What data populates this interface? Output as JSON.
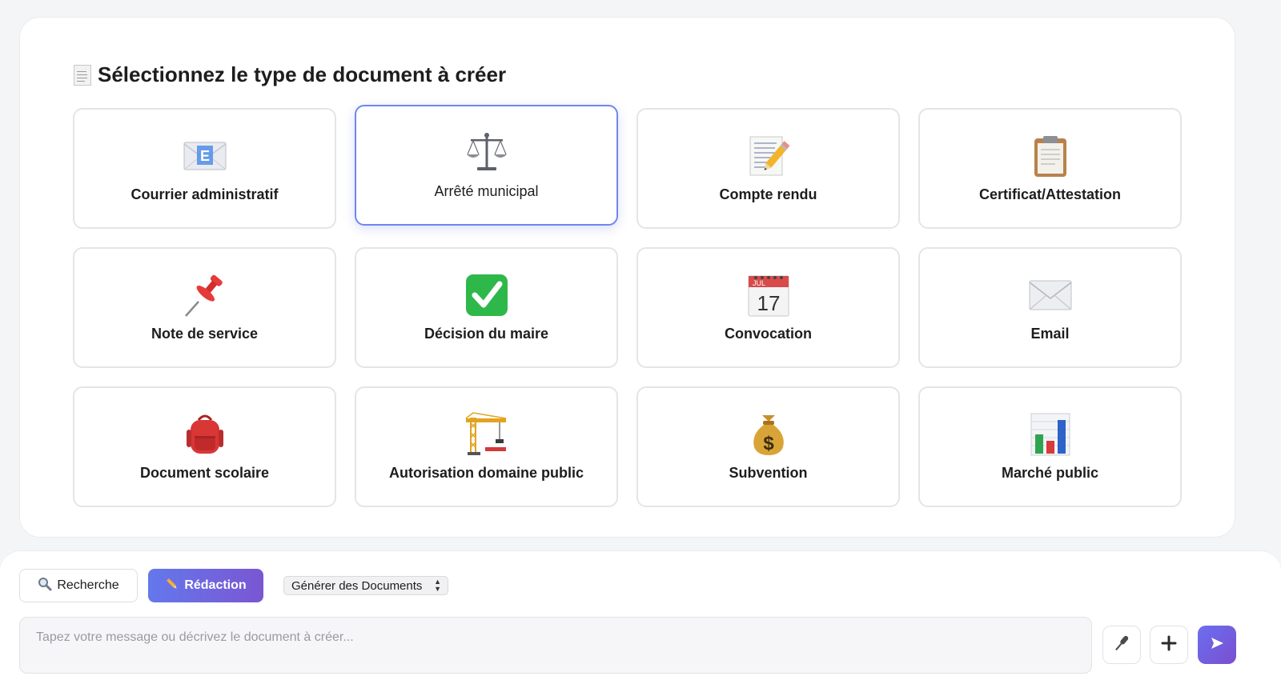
{
  "section_title": "Sélectionnez le type de document à créer",
  "document_types": [
    {
      "label": "Courrier administratif",
      "icon": "envelope-e-icon",
      "selected": false
    },
    {
      "label": "Arrêté municipal",
      "icon": "balance-scale-icon",
      "selected": true
    },
    {
      "label": "Compte rendu",
      "icon": "memo-pencil-icon",
      "selected": false
    },
    {
      "label": "Certificat/Attestation",
      "icon": "clipboard-icon",
      "selected": false
    },
    {
      "label": "Note de service",
      "icon": "pushpin-icon",
      "selected": false
    },
    {
      "label": "Décision du maire",
      "icon": "check-mark-icon",
      "selected": false
    },
    {
      "label": "Convocation",
      "icon": "calendar-icon",
      "selected": false
    },
    {
      "label": "Email",
      "icon": "envelope-icon",
      "selected": false
    },
    {
      "label": "Document scolaire",
      "icon": "backpack-icon",
      "selected": false
    },
    {
      "label": "Autorisation domaine public",
      "icon": "construction-crane-icon",
      "selected": false
    },
    {
      "label": "Subvention",
      "icon": "money-bag-icon",
      "selected": false
    },
    {
      "label": "Marché public",
      "icon": "bar-chart-icon",
      "selected": false
    }
  ],
  "calendar": {
    "month": "JUL",
    "day": "17"
  },
  "money_symbol": "$",
  "envelope_letter": "E",
  "toolbar": {
    "recherche_label": "Recherche",
    "redaction_label": "Rédaction",
    "mode_select_value": "Générer des Documents"
  },
  "composer": {
    "placeholder": "Tapez votre message ou décrivez le document à créer..."
  },
  "colors": {
    "accent_start": "#6478ec",
    "accent_end": "#7a56d2",
    "selected_border": "#6f86f0"
  }
}
